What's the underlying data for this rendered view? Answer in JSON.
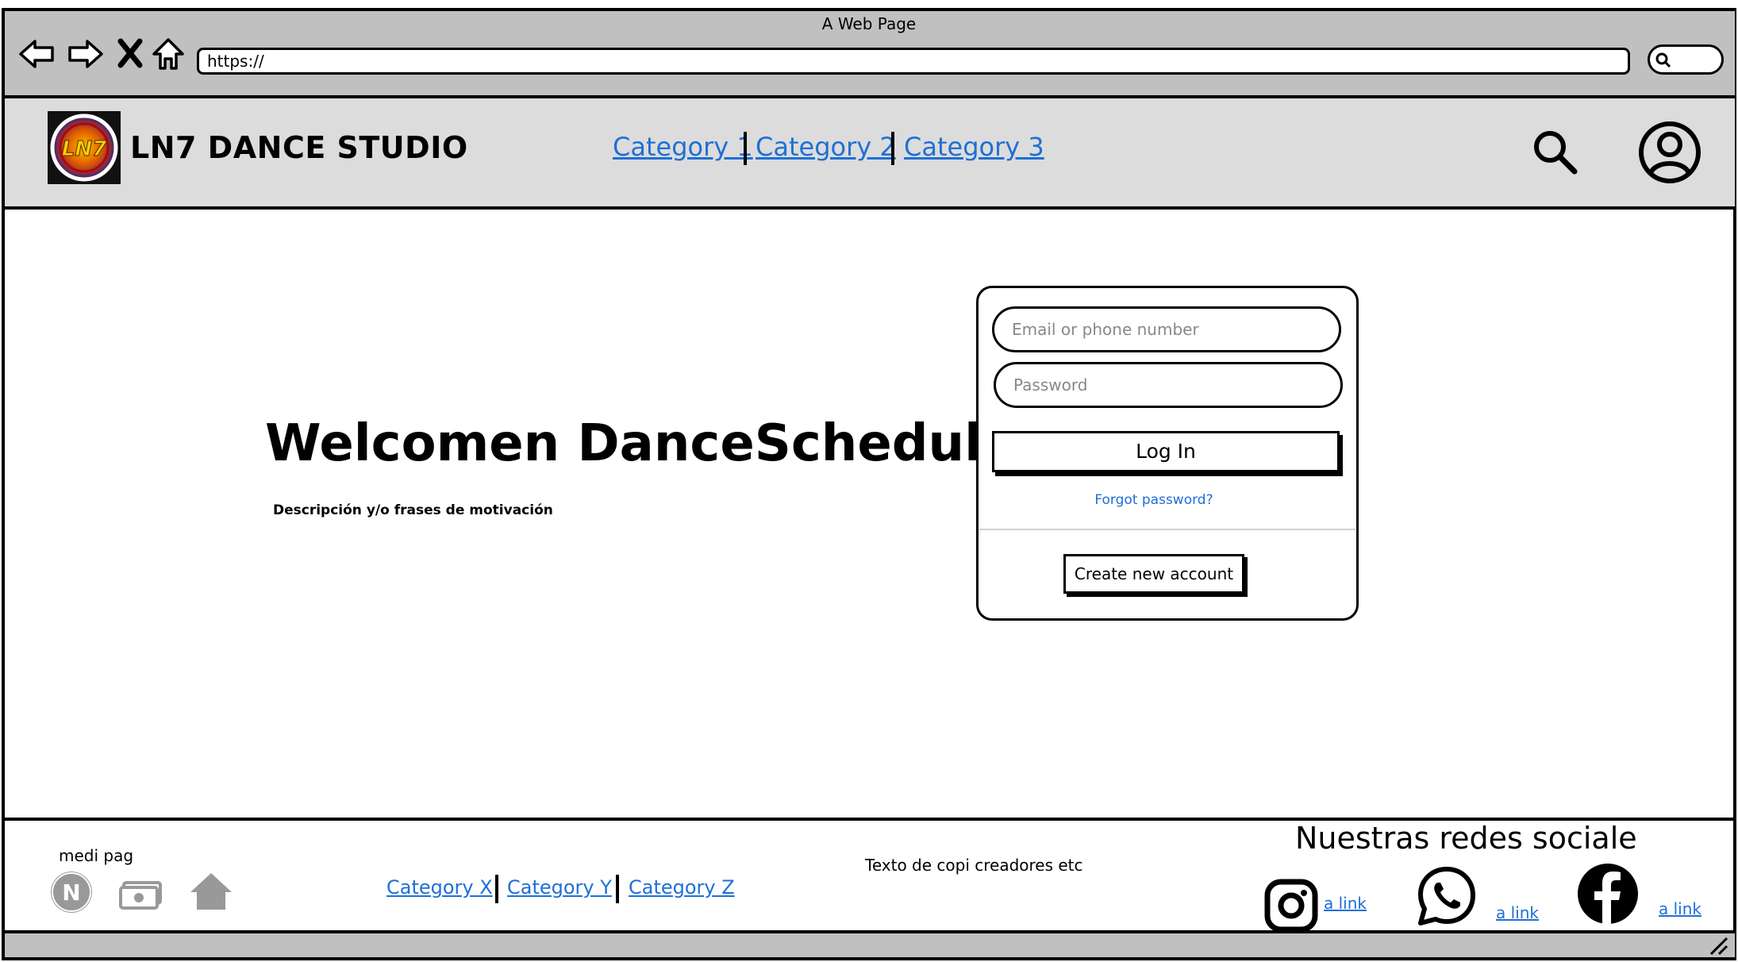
{
  "browser": {
    "window_title": "A Web Page",
    "url": "https://",
    "nav_icons": [
      "back-arrow-icon",
      "forward-arrow-icon",
      "stop-x-icon",
      "home-icon"
    ]
  },
  "header": {
    "logo_text": "LN7",
    "brand": "LN7 DANCE STUDIO",
    "nav": [
      "Category 1",
      "Category 2",
      "Category 3"
    ],
    "icons": [
      "search-icon",
      "user-profile-icon"
    ]
  },
  "main": {
    "title": "Welcomen DanceScheduler",
    "subtitle": "Descripción y/o frases de motivación"
  },
  "login": {
    "email_placeholder": "Email or phone number",
    "password_placeholder": "Password",
    "login_label": "Log In",
    "forgot_label": "Forgot password?",
    "create_label": "Create new account"
  },
  "footer": {
    "medi_label": "medi pag",
    "payment_icons": [
      "n-circle-icon",
      "money-icon",
      "home-icon"
    ],
    "links": [
      "Category X",
      "Category Y",
      "Category Z"
    ],
    "copyright": "Texto de copi creadores etc",
    "social_title": "Nuestras redes sociale",
    "social": [
      {
        "icon": "instagram-icon",
        "link": "a link"
      },
      {
        "icon": "whatsapp-icon",
        "link": "a link"
      },
      {
        "icon": "facebook-icon",
        "link": "a link"
      }
    ]
  },
  "colors": {
    "link": "#1f6fd6",
    "chrome": "#c0c0c0",
    "header_bg": "#dcdcdc",
    "muted_icon": "#999999"
  }
}
